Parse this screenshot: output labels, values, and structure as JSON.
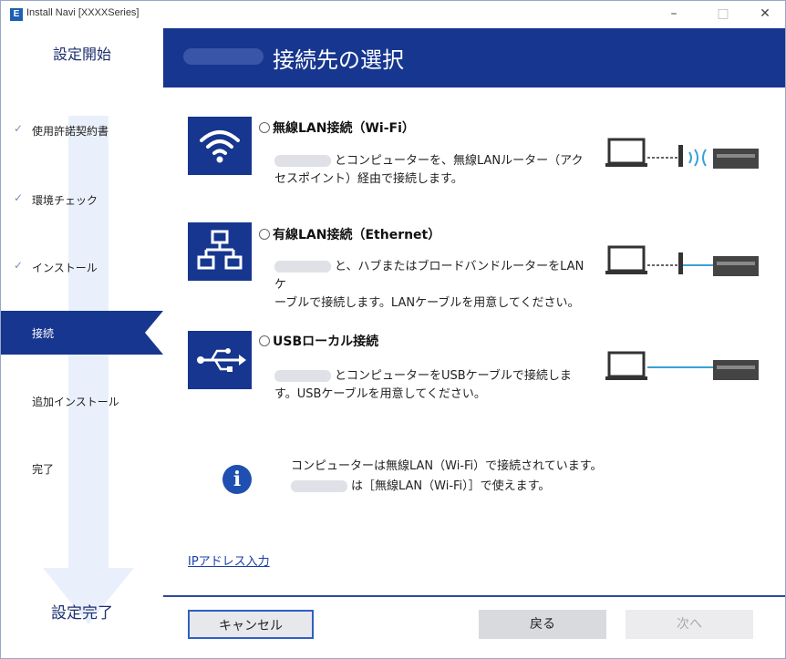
{
  "window": {
    "title": "Install Navi [XXXXSeries]",
    "app_icon_glyph": "E",
    "minimize": "–",
    "maximize": "□",
    "close": "✕"
  },
  "sidebar": {
    "start_label": "設定開始",
    "done_label": "設定完了",
    "steps": [
      {
        "label": "使用許諾契約書",
        "checked": true
      },
      {
        "label": "環境チェック",
        "checked": true
      },
      {
        "label": "インストール",
        "checked": true
      },
      {
        "label": "接続",
        "active": true
      },
      {
        "label": "追加インストール"
      },
      {
        "label": "完了"
      }
    ],
    "check_glyph": "✓"
  },
  "header": {
    "title": "接続先の選択"
  },
  "options": [
    {
      "icon": "wifi-icon",
      "title": "無線LAN接続（Wi-Fi）",
      "desc_line1": "とコンピューターを、無線LANルーター（アク",
      "desc_line2": "セスポイント）経由で接続します。"
    },
    {
      "icon": "ethernet-icon",
      "title": "有線LAN接続（Ethernet）",
      "desc_line1": "と、ハブまたはブロードバンドルーターをLANケ",
      "desc_line2": "ーブルで接続します。LANケーブルを用意してください。"
    },
    {
      "icon": "usb-icon",
      "title": "USBローカル接続",
      "desc_line1": "とコンピューターをUSBケーブルで接続しま",
      "desc_line2": "す。USBケーブルを用意してください。"
    }
  ],
  "info": {
    "line1": "コンピューターは無線LAN（Wi-Fi）で接続されています。",
    "line2": "は［無線LAN（Wi-Fi）］で使えます。"
  },
  "ip_link": "IPアドレス入力",
  "buttons": {
    "cancel": "キャンセル",
    "back": "戻る",
    "next": "次へ"
  },
  "colors": {
    "accent": "#16368f",
    "link": "#1a3ea8",
    "info": "#1f4fb0",
    "cable": "#3aa0d8"
  }
}
